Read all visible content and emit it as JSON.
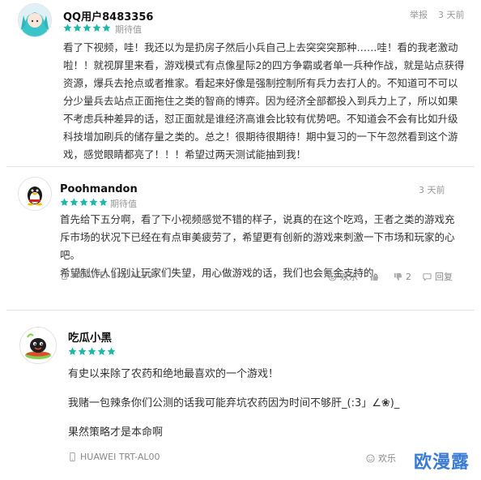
{
  "reviews": [
    {
      "username": "QQ用户8483356",
      "rating_text": "期待值",
      "stars": 5,
      "report_label": "举报",
      "time": "3 天前",
      "paragraphs": [
        "看了下视频，哇！我还以为是扔房子然后小兵自己上去突突突那种……哇！看的我老激动啦！！就视屏里来看，游戏模式有点像星际2的四方争霸或者单一兵种作战，就是站点获得资源，爆兵去抢点或者推家。看起来好像是强制控制所有兵力去打人的。不知道可不可以分少量兵去站点正面拖住之类的智商的博弈。因为经济全部都投入到兵力上了，所以如果不考虑兵种差异的话，怼正面就是谁经济高谁会比较有优势吧。不知道会不会有比如升级科技增加刷兵的储存量之类的。总之！很期待很期待！期中复习的一下午忽然看到这个游戏，感觉眼睛都亮了！！！希望过两天测试能抽到我！"
      ]
    },
    {
      "username": "Poohmandon",
      "rating_text": "期待值",
      "stars": 5,
      "time": "3 天前",
      "paragraphs": [
        "首先给下五分啊，看了下小视频感觉不错的样子，说真的在这个吃鸡，王者之类的游戏充斥市场的状况下已经在有点审美疲劳了，希望更有创新的游戏来刺激一下市场和玩家的心吧。",
        "希望制作人们别让玩家们失望，用心做游戏的话，我们也会氪金支持的。"
      ],
      "device": "HUAWEI BKL-AL20",
      "actions": {
        "happy_label": "欢乐",
        "like_count": "",
        "dislike_count": "2",
        "reply_label": "回复"
      }
    },
    {
      "username": "吃瓜小黑",
      "stars": 5,
      "paragraphs": [
        "有史以来除了农药和绝地最喜欢的一个游戏！",
        "我赌一包辣条你们公测的话我可能弃坑农药因为时间不够肝_(:3」∠❀)_",
        "果然策略才是本命啊"
      ],
      "device": "HUAWEI TRT-AL00",
      "actions": {
        "happy_label": "欢乐"
      }
    }
  ],
  "watermark": "欧漫露",
  "colors": {
    "star": "#1fb8a8",
    "divider": "#e4e4e4",
    "watermark": "#3a7bd5"
  }
}
